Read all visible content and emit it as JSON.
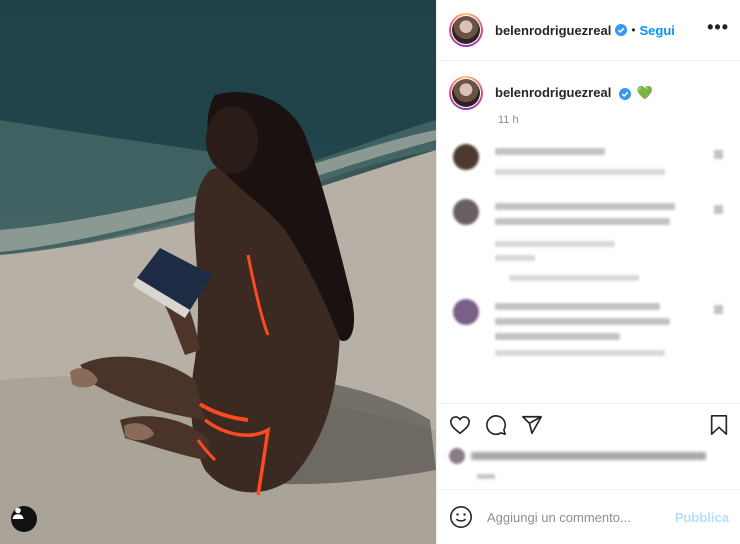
{
  "post": {
    "username": "belenrodriguezreal",
    "verified": true,
    "follow_label": "Segui",
    "separator": "•",
    "more_label": "•••",
    "caption_emoji": "💚",
    "time_ago": "11 h"
  },
  "comment_box": {
    "placeholder": "Aggiungi un commento...",
    "publish_label": "Pubblica"
  },
  "colors": {
    "accent": "#0095f6",
    "publish_disabled": "#b2dffc",
    "divider": "#efefef",
    "muted": "#8e8e8e"
  },
  "icons": {
    "header": [
      "verified-icon",
      "more-options-icon"
    ],
    "actions": [
      "heart-icon",
      "comment-icon",
      "share-icon",
      "save-icon"
    ],
    "photo": [
      "user-tag-icon"
    ],
    "comment_box": [
      "emoji-icon"
    ]
  }
}
